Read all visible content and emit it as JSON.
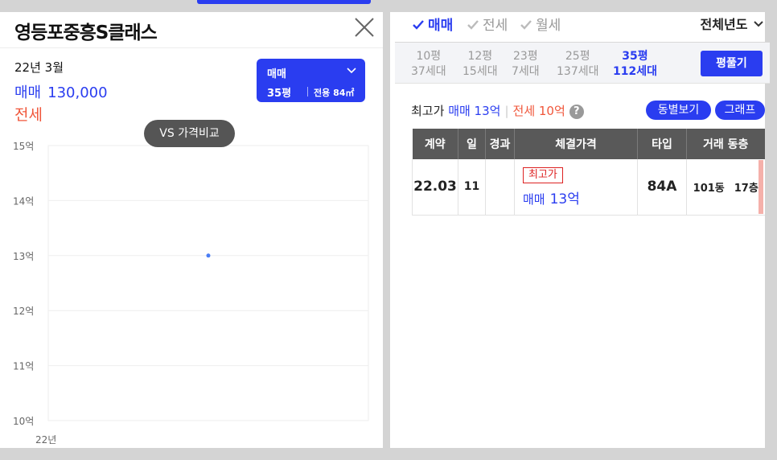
{
  "left": {
    "title": "영등포중흥S클래스",
    "date_label": "22년 3월",
    "sale_label": "매매",
    "sale_value": "130,000",
    "jeonse_label": "전세",
    "selector": {
      "type": "매매",
      "size": "35평",
      "area_prefix": "전용",
      "area": "84㎡"
    },
    "vs_button": "VS 가격비교"
  },
  "right": {
    "tabs": [
      {
        "label": "매매",
        "active": true
      },
      {
        "label": "전세",
        "active": false
      },
      {
        "label": "월세",
        "active": false
      }
    ],
    "year_select": "전체년도",
    "sizes": [
      {
        "pyeong": "10평",
        "units": "37세대",
        "active": false
      },
      {
        "pyeong": "12평",
        "units": "15세대",
        "active": false
      },
      {
        "pyeong": "23평",
        "units": "7세대",
        "active": false
      },
      {
        "pyeong": "25평",
        "units": "137세대",
        "active": false
      },
      {
        "pyeong": "35평",
        "units": "112세대",
        "active": true
      }
    ],
    "pyeong_button": "평풀기",
    "max_label": "최고가",
    "max_sale": "매매 13억",
    "max_jeonse": "전세 10억",
    "help_icon": "?",
    "dong_button": "동별보기",
    "graph_button": "그래프",
    "table": {
      "headers": [
        "계약",
        "일",
        "경과",
        "체결가격",
        "타입",
        "거래 동층"
      ],
      "rows": [
        {
          "contract": "22.03",
          "day": "11",
          "elapsed": "",
          "badge": "최고가",
          "price_type": "매매",
          "price": "13억",
          "type": "84A",
          "dong": "101동",
          "floor": "17층"
        }
      ]
    }
  },
  "chart_data": {
    "type": "scatter",
    "x_tick_labels": [
      "22년"
    ],
    "y_tick_labels": [
      "15억",
      "14억",
      "13억",
      "12억",
      "11억",
      "10억"
    ],
    "ylim": [
      10,
      15
    ],
    "grid": true,
    "series": [
      {
        "x": [
          "22년 3월"
        ],
        "values": [
          13
        ],
        "color": "#4a7df5"
      }
    ]
  },
  "colors": {
    "accent": "#2a3df0",
    "jeonse": "#f0563a",
    "header": "#595959",
    "badge": "#dd2222"
  }
}
